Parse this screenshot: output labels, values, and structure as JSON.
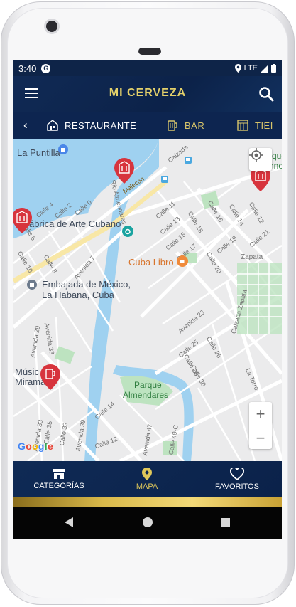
{
  "status_bar": {
    "time": "3:40",
    "app_badge": "G",
    "network": "LTE"
  },
  "app_bar": {
    "title": "MI CERVEZA",
    "menu_icon": "hamburger-icon",
    "search_icon": "search-icon"
  },
  "categories": {
    "back_icon": "chevron-left-icon",
    "items": [
      {
        "label": "RESTAURANTE",
        "icon": "house-icon"
      },
      {
        "label": "BAR",
        "icon": "beer-mug-icon"
      },
      {
        "label": "TIEI",
        "icon": "storefront-icon"
      }
    ]
  },
  "map": {
    "places": {
      "puntilla": "La Puntilla",
      "fabrica": "Fábrica de Arte Cubano",
      "cuba_libro": "Cuba Libro",
      "embajada_l1": "Embajada de México,",
      "embajada_l2": "La Habana, Cuba",
      "parque_l1": "Parque",
      "parque_l2": "Almendares",
      "musica_l1": "Músic",
      "musica_l2": "Miramar",
      "parque_partial_l1": "rque",
      "parque_partial_l2": "hnos",
      "zapata": "Zapata"
    },
    "streets": {
      "calzada": "Calzada",
      "malecon": "Malecon",
      "rio": "Río Almendares",
      "calle4": "Calle 4",
      "calle2": "Calle 2",
      "calle0": "Calle 0",
      "calle11": "Calle 11",
      "calle13": "Calle 13",
      "calle15": "Calle 15",
      "calle18": "Calle 18",
      "calle16": "Calle 16",
      "calle14": "Calle 14",
      "calle12": "Calle 12",
      "calle17": "Calle 17",
      "calle19": "Calle 19",
      "calle20": "Calle 20",
      "calle21": "Calle 21",
      "calle6": "Calle 6",
      "calle8": "Calle 8",
      "calle10": "Calle 10",
      "avenida7": "Avenida 7",
      "avenida23": "Avenida 23",
      "calle25": "Calle 25",
      "calle26": "Calle 26",
      "calle28": "Calle 28",
      "calle30": "Calle 30",
      "calzada_zapata": "Calzada Zapata",
      "la_torre": "La Torre",
      "avenida29": "Avenida 29",
      "avenida33": "Avenida 33",
      "avenida31": "Avenida 31",
      "calle33": "Calle 33",
      "calle35": "Calle 35",
      "avenida39": "Avenida 39",
      "calle14b": "Calle 14",
      "calle12b": "Calle 12",
      "avenida47": "Avenida 47",
      "calle49c": "Calle 49-C"
    },
    "locate_icon": "crosshair-icon",
    "zoom_in": "+",
    "zoom_out": "−",
    "google_logo": "Google",
    "pins": [
      {
        "icon": "restaurant-pin-icon",
        "color": "#d7343d"
      },
      {
        "icon": "restaurant-pin-icon",
        "color": "#d7343d"
      },
      {
        "icon": "restaurant-pin-icon",
        "color": "#d7343d"
      },
      {
        "icon": "bar-pin-icon",
        "color": "#d7343d"
      }
    ]
  },
  "bottom_nav": [
    {
      "label": "CATEGORÍAS",
      "icon": "store-icon",
      "active": false
    },
    {
      "label": "MAPA",
      "icon": "map-pin-icon",
      "active": true
    },
    {
      "label": "FAVORITOS",
      "icon": "heart-icon",
      "active": false
    }
  ],
  "colors": {
    "navy": "#0e2448",
    "gold": "#d8c56a",
    "pin_red": "#d7343d",
    "water": "#9fd1f0",
    "park": "#bde3c0"
  }
}
